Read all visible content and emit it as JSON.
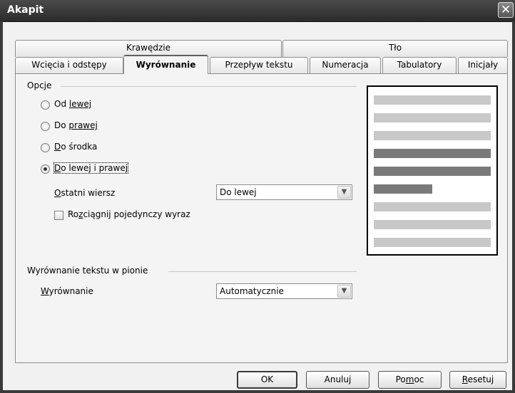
{
  "window": {
    "title": "Akapit",
    "close_glyph": "✕"
  },
  "tabs_row1": [
    {
      "label": "Krawędzie"
    },
    {
      "label": "Tło"
    }
  ],
  "tabs_row2": [
    {
      "label": "Wcięcia i odstępy"
    },
    {
      "label": "Wyrównanie",
      "active": true
    },
    {
      "label": "Przepływ tekstu"
    },
    {
      "label": "Numeracja"
    },
    {
      "label": "Tabulatory"
    },
    {
      "label": "Inicjały"
    }
  ],
  "options": {
    "title": "Opcje",
    "radios": [
      {
        "label": "Od lewej",
        "checked": false
      },
      {
        "label": "Do prawej",
        "checked": false
      },
      {
        "label": "Do środka",
        "checked": false
      },
      {
        "label": "Do lewej i prawej",
        "checked": true
      }
    ],
    "last_line_label": "Ostatni wiersz",
    "last_line_value": "Do lewej",
    "stretch_label": "Rozciągnij pojedynczy wyraz",
    "stretch_checked": false
  },
  "vertical": {
    "title": "Wyrównanie tekstu w pionie",
    "alignment_label": "Wyrównanie",
    "alignment_value": "Automatycznie"
  },
  "preview": {
    "lines": [
      {
        "tone": "light",
        "fill": 1.0
      },
      {
        "tone": "light",
        "fill": 1.0
      },
      {
        "tone": "light",
        "fill": 1.0
      },
      {
        "tone": "dark",
        "fill": 1.0
      },
      {
        "tone": "dark",
        "fill": 1.0
      },
      {
        "tone": "dark",
        "fill": 0.5
      },
      {
        "tone": "light",
        "fill": 1.0
      },
      {
        "tone": "light",
        "fill": 1.0
      },
      {
        "tone": "light",
        "fill": 1.0
      }
    ],
    "colors": {
      "light": "#c8c8c8",
      "dark": "#7a7a7a"
    }
  },
  "buttons": {
    "ok": "OK",
    "cancel": "Anuluj",
    "help": "Pomoc",
    "reset": "Resetuj"
  }
}
